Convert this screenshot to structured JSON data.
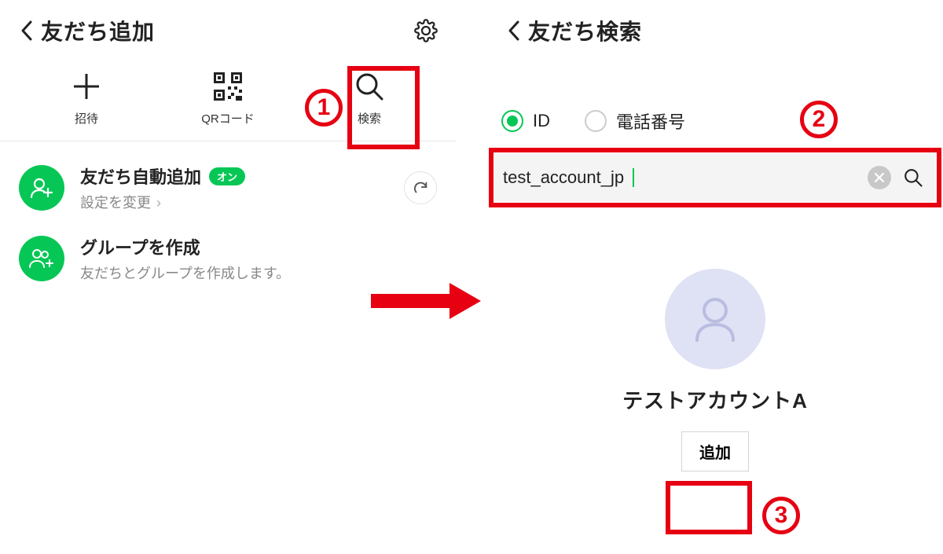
{
  "left": {
    "header": {
      "title": "友だち追加"
    },
    "icons": {
      "invite": {
        "label": "招待"
      },
      "qr": {
        "label": "QRコード"
      },
      "search": {
        "label": "検索"
      }
    },
    "rows": {
      "auto_add": {
        "title": "友だち自動追加",
        "badge": "オン",
        "subtitle": "設定を変更"
      },
      "group": {
        "title": "グループを作成",
        "subtitle": "友だちとグループを作成します。"
      }
    }
  },
  "right": {
    "header": {
      "title": "友だち検索"
    },
    "radios": {
      "id": {
        "label": "ID",
        "selected": true
      },
      "phone": {
        "label": "電話番号",
        "selected": false
      }
    },
    "search": {
      "value": "test_account_jp"
    },
    "result": {
      "name": "テストアカウントA",
      "add_button": "追加"
    }
  },
  "steps": {
    "s1": "1",
    "s2": "2",
    "s3": "3"
  },
  "colors": {
    "accent": "#06c755",
    "highlight": "#e60012"
  }
}
